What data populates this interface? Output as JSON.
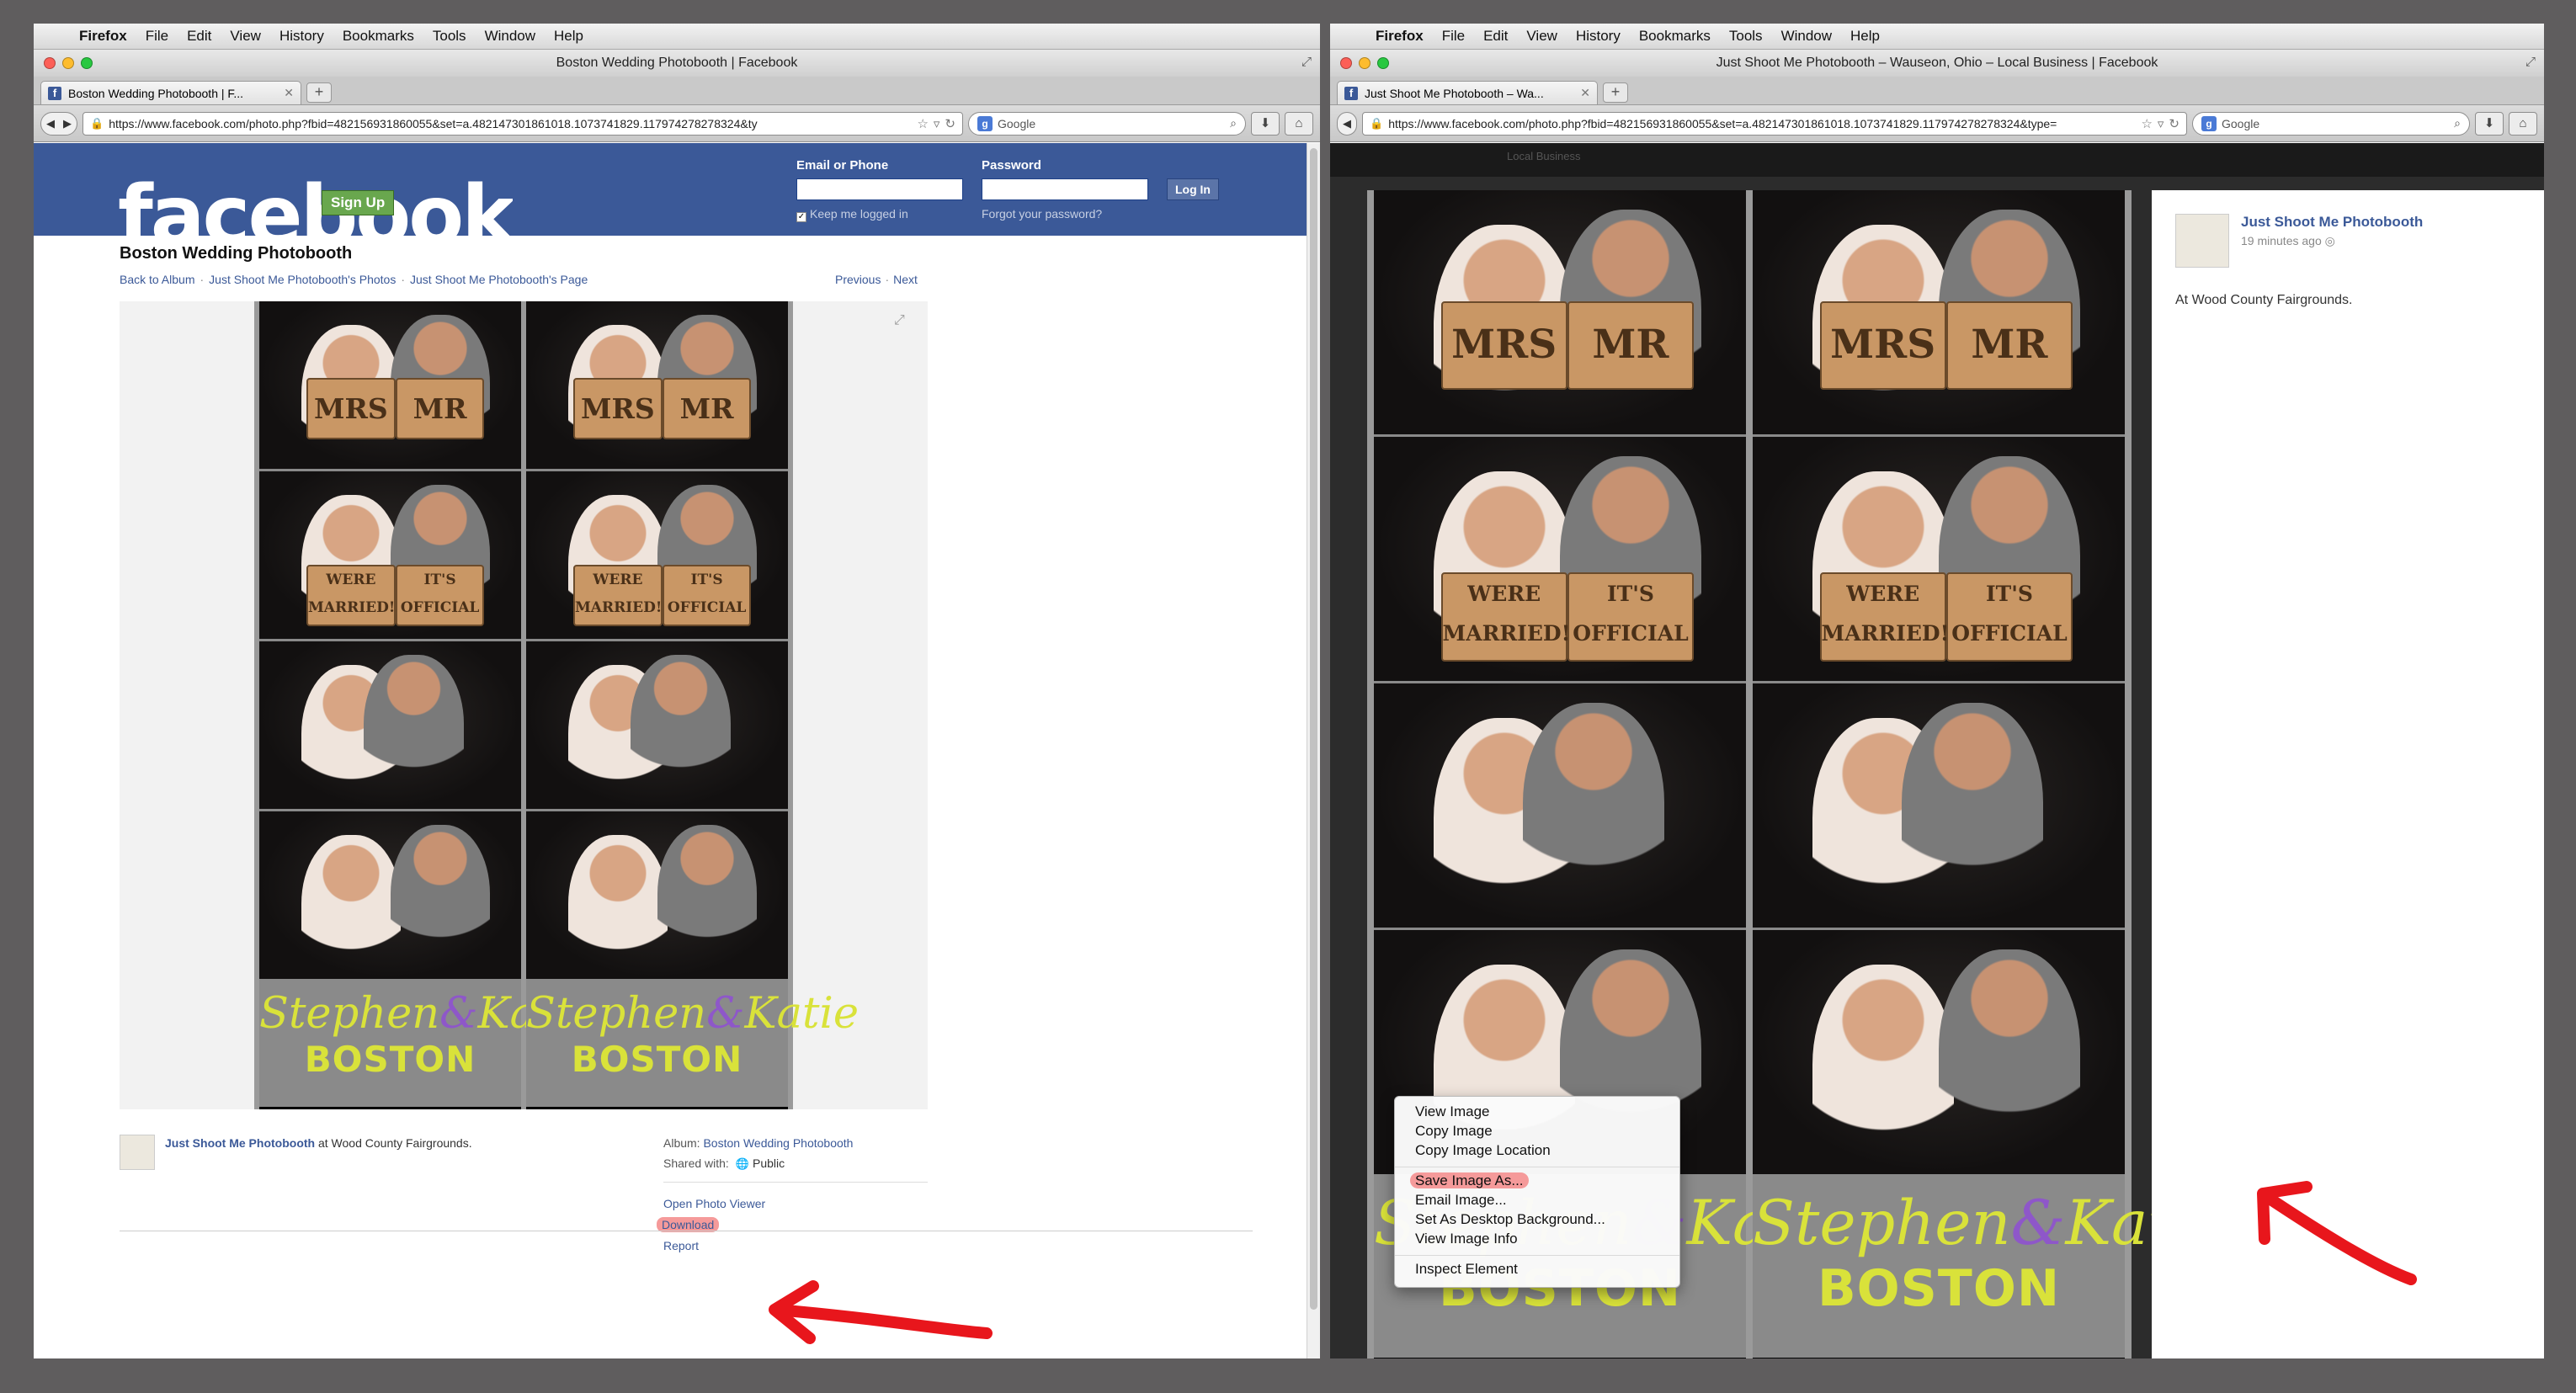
{
  "menubar": {
    "app": "Firefox",
    "items": [
      "File",
      "Edit",
      "View",
      "History",
      "Bookmarks",
      "Tools",
      "Window",
      "Help"
    ]
  },
  "left": {
    "window_title": "Boston Wedding Photobooth | Facebook",
    "tab_label": "Boston Wedding Photobooth | F...",
    "url": "https://www.facebook.com/photo.php?fbid=482156931860055&set=a.482147301861018.1073741829.117974278278324&ty",
    "search_engine": "Google",
    "fb": {
      "logo": "facebook",
      "signup": "Sign Up",
      "email_label": "Email or Phone",
      "password_label": "Password",
      "login_button": "Log In",
      "keep_logged_in": "Keep me logged in",
      "forgot": "Forgot your password?"
    },
    "album_title": "Boston Wedding Photobooth",
    "crumbs": [
      "Back to Album",
      "Just Shoot Me Photobooth's Photos",
      "Just Shoot Me Photobooth's Page"
    ],
    "prev": "Previous",
    "next": "Next",
    "meta": {
      "page_name": "Just Shoot Me Photobooth",
      "at_text": "at Wood County Fairgrounds.",
      "album_label": "Album:",
      "album_name": "Boston Wedding Photobooth",
      "shared_label": "Shared with:",
      "shared_value": "Public"
    },
    "actions": [
      "Open Photo Viewer",
      "Download",
      "Report"
    ]
  },
  "right": {
    "window_title": "Just Shoot Me Photobooth – Wauseon, Ohio – Local Business | Facebook",
    "tab_label": "Just Shoot Me Photobooth – Wa...",
    "url": "https://www.facebook.com/photo.php?fbid=482156931860055&set=a.482147301861018.1073741829.117974278278324&type=",
    "search_engine": "Google",
    "dark_label": "Local Business",
    "page_name": "Just Shoot Me Photobooth",
    "time": "19 minutes ago",
    "location": "At Wood County Fairgrounds."
  },
  "photo": {
    "signs": [
      "MRS",
      "MR",
      "WERE MARRIED!",
      "IT'S OFFICIAL"
    ],
    "names_first": "Stephen",
    "names_amp": "&",
    "names_second": "Katie",
    "city": "BOSTON"
  },
  "context_menu": {
    "group1": [
      "View Image",
      "Copy Image",
      "Copy Image Location"
    ],
    "group2": [
      "Save Image As...",
      "Email Image...",
      "Set As Desktop Background...",
      "View Image Info"
    ],
    "group3": [
      "Inspect Element"
    ]
  },
  "colors": {
    "facebook_blue": "#3b5998",
    "highlight": "#f59a9a",
    "arrow_red": "#e8161c",
    "caption_yellow": "#d9e23a",
    "caption_purple": "#8e57c9"
  }
}
